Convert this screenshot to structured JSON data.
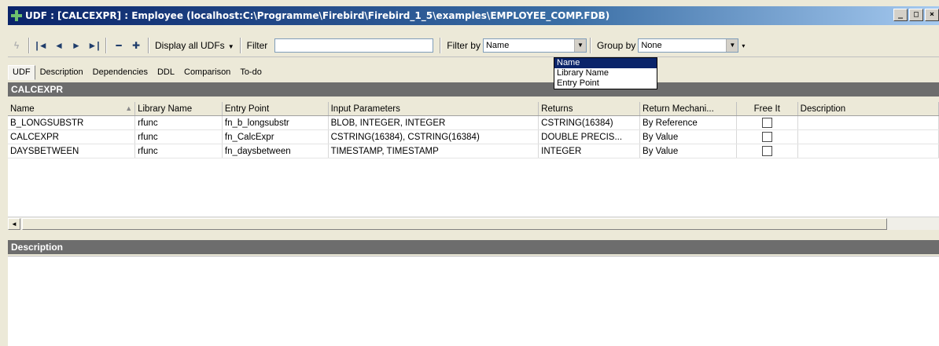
{
  "window": {
    "title": "UDF : [CALCEXPR] : Employee (localhost:C:\\Programme\\Firebird\\Firebird_1_5\\examples\\EMPLOYEE_COMP.FDB)",
    "controls": [
      "_",
      "□",
      "×"
    ]
  },
  "toolbar": {
    "display_all_label": "Display all UDFs",
    "filter_label": "Filter",
    "filter_value": "",
    "filter_by_label": "Filter by",
    "filter_by_value": "Name",
    "group_by_label": "Group by",
    "group_by_value": "None",
    "nav_icons": [
      "lightning-icon",
      "first-record-icon",
      "prev-record-icon",
      "next-record-icon",
      "last-record-icon",
      "delete-icon",
      "add-icon"
    ]
  },
  "filter_by_options": [
    "Name",
    "Library Name",
    "Entry Point"
  ],
  "tabs": [
    "UDF",
    "Description",
    "Dependencies",
    "DDL",
    "Comparison",
    "To-do"
  ],
  "grid": {
    "section_title": "CALCEXPR",
    "columns": [
      "Name",
      "Library Name",
      "Entry Point",
      "Input Parameters",
      "Returns",
      "Return Mechani...",
      "Free It",
      "Description"
    ],
    "rows": [
      [
        "B_LONGSUBSTR",
        "rfunc",
        "fn_b_longsubstr",
        "BLOB, INTEGER, INTEGER",
        "CSTRING(16384)",
        "By Reference",
        false,
        ""
      ],
      [
        "CALCEXPR",
        "rfunc",
        "fn_CalcExpr",
        "CSTRING(16384), CSTRING(16384)",
        "DOUBLE PRECIS...",
        "By Value",
        false,
        ""
      ],
      [
        "DAYSBETWEEN",
        "rfunc",
        "fn_daysbetween",
        "TIMESTAMP, TIMESTAMP",
        "INTEGER",
        "By Value",
        false,
        ""
      ]
    ]
  },
  "description_panel": {
    "title": "Description"
  }
}
